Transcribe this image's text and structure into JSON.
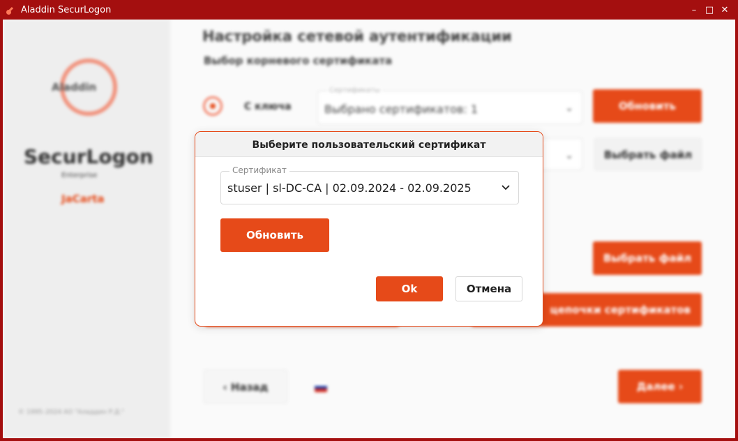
{
  "window": {
    "title": "Aladdin SecurLogon",
    "controls": [
      "minimize-icon",
      "maximize-icon",
      "close-icon"
    ]
  },
  "colors": {
    "accent": "#e64a19",
    "titlebar": "#a40f0f"
  },
  "sidebar": {
    "logo_text": "Aladdin",
    "product_name": "SecurLogon",
    "edition": "Enterprise",
    "product_tag": "JaCarta",
    "note": "",
    "copyright": "© 1995–2024 АО \"Аладдин Р.Д.\""
  },
  "main": {
    "title": "Настройка сетевой аутентификации",
    "subtitle": "Выбор корневого сертификата",
    "option_label": "С ключа",
    "certificates_field": {
      "label": "Сертификаты",
      "value": "Выбрано сертификатов: 1"
    },
    "refresh_label": "Обновить",
    "choose_file_label": "Выбрать файл",
    "choose_file_label_2": "Выбрать файл",
    "chain_label": "цепочки сертификатов",
    "back_label": "Назад",
    "next_label": "Далее"
  },
  "dialog": {
    "title": "Выберите пользовательский сертификат",
    "certificate": {
      "label": "Сертификат",
      "value": "stuser | sl-DC-CA | 02.09.2024 - 02.09.2025"
    },
    "refresh_label": "Обновить",
    "ok_label": "Ok",
    "cancel_label": "Отмена"
  }
}
